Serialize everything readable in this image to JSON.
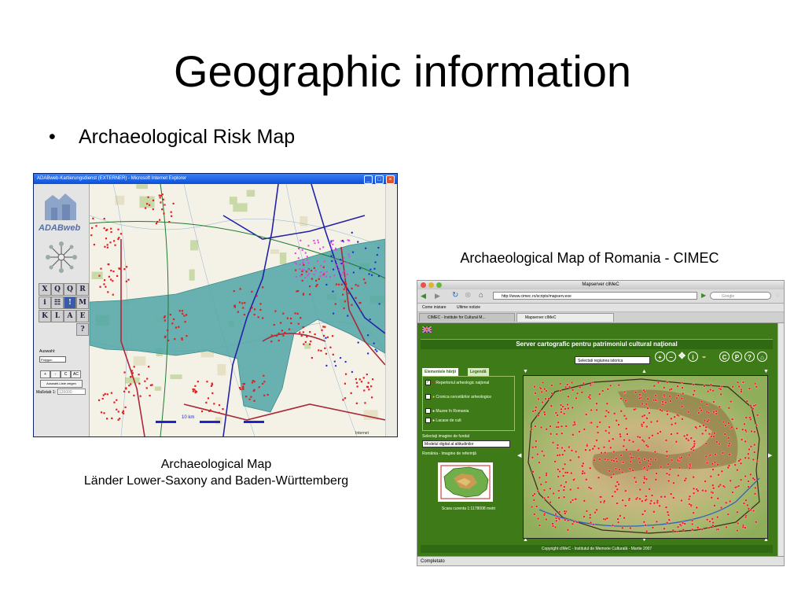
{
  "slide": {
    "title": "Geographic information",
    "bullet": "Archaeological Risk Map",
    "bullet_symbol": "•",
    "caption_left_line1": "Archaeological Map",
    "caption_left_line2": "Länder Lower-Saxony and Baden-Württemberg",
    "caption_right": "Archaeological Map of Romania - CIMEC"
  },
  "left_window": {
    "title": "ADABweb-Kartierungsdienst (EXTERNER) - Microsoft Internet Explorer",
    "logo_text": "ADABweb",
    "tools": [
      "X",
      "Q",
      "Q",
      "R",
      "i",
      "☷",
      "!",
      "M",
      "K",
      "L",
      "A",
      "E",
      "?"
    ],
    "auswahl_label": "Auswahl:",
    "auswahl_value": "Polygon",
    "buttons": [
      "+",
      "-",
      "C",
      "AC"
    ],
    "liste_button": "Auswahl-Liste zeigen",
    "massstab_label": "Maßstab 1:",
    "massstab_value": "120000",
    "scale_bar_label": "10 km",
    "status_text": "Internet"
  },
  "right_window": {
    "window_title": "Mapserver cIMeC",
    "url": "http://www.cimec.ro/scripts/mapserv.exe",
    "search_placeholder": "Google",
    "bookmarks": [
      "Come iniziare",
      "Ultime notizie"
    ],
    "tabs": [
      "CIMEC - Institute for Cultural M...",
      "Mapserver cIMeC"
    ],
    "header": "Server cartografic pentru patrimoniul cultural naţional",
    "region_select": "Selectati regiunea istorica",
    "panel_tabs": [
      "Elementele hărţii",
      "Legendă"
    ],
    "layers": [
      {
        "label": "Repertoriul arheologic naţional",
        "checked": true
      },
      {
        "label": "Cronica cercetărilor arheologice",
        "checked": false
      },
      {
        "label": "Muzee în Romania",
        "checked": false
      },
      {
        "label": "Lacase de cult",
        "checked": false
      }
    ],
    "bg_label": "Selectaţi imagine de fundal",
    "bg_value": "Modelul digital al altitudinilor",
    "ref_label": "România - Imagine de referinţă",
    "scale_text": "Scara curenta 1:1178008 metri",
    "copyright": "Copyright cIMeC - Institutul de Memorie Culturală - Martie 2007",
    "status": "Completato"
  },
  "colors": {
    "risk_zone": "#4fa6a6",
    "site_red": "#e02020",
    "site_magenta": "#e040e0",
    "cimec_green": "#3f7a18"
  }
}
